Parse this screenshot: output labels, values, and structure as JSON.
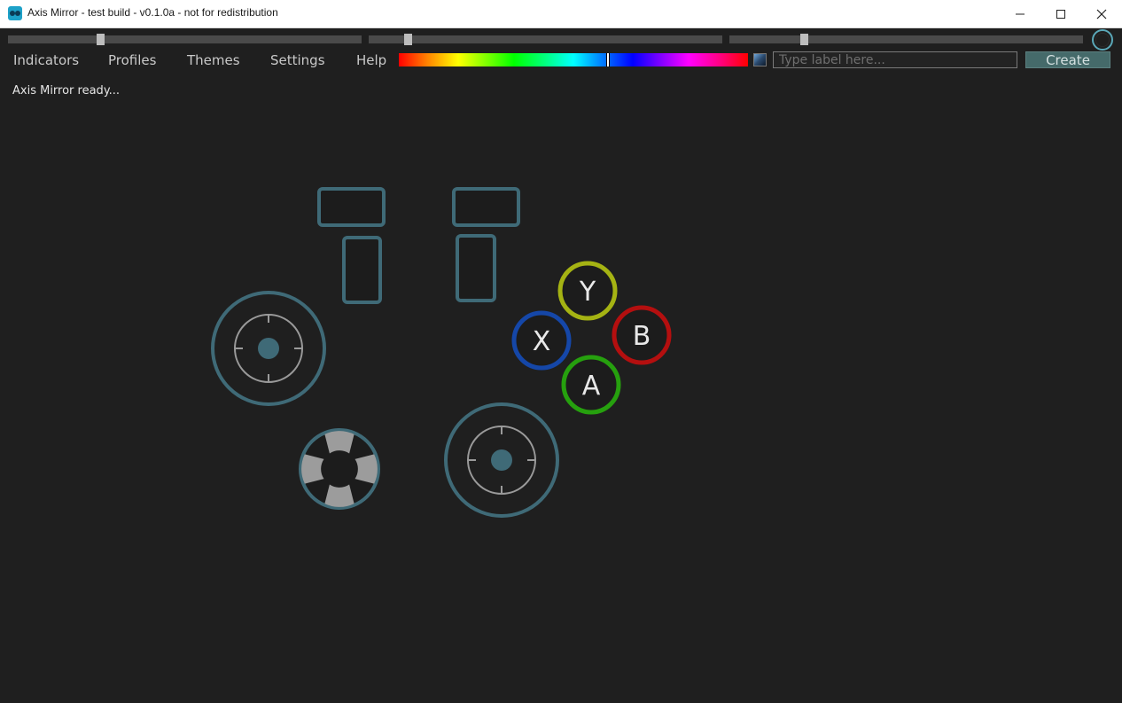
{
  "window": {
    "title": "Axis Mirror - test build - v0.1.0a - not for redistribution"
  },
  "sliders": [
    {
      "value": 0.26
    },
    {
      "value": 0.11
    },
    {
      "value": 0.21
    }
  ],
  "menu": {
    "items": [
      "Indicators",
      "Profiles",
      "Themes",
      "Settings",
      "Help"
    ]
  },
  "color_picker": {
    "hue_fraction": 0.6
  },
  "label_input": {
    "value": "",
    "placeholder": "Type label here..."
  },
  "create_button": {
    "label": "Create"
  },
  "status": {
    "text": "Axis Mirror ready..."
  },
  "controller": {
    "face_buttons": [
      {
        "label": "Y",
        "color": "#a5b313"
      },
      {
        "label": "X",
        "color": "#1547a8"
      },
      {
        "label": "B",
        "color": "#b40f0f"
      },
      {
        "label": "A",
        "color": "#26a00e"
      }
    ],
    "outline_color": "#3f6a77",
    "background": "#1f1f1f"
  }
}
